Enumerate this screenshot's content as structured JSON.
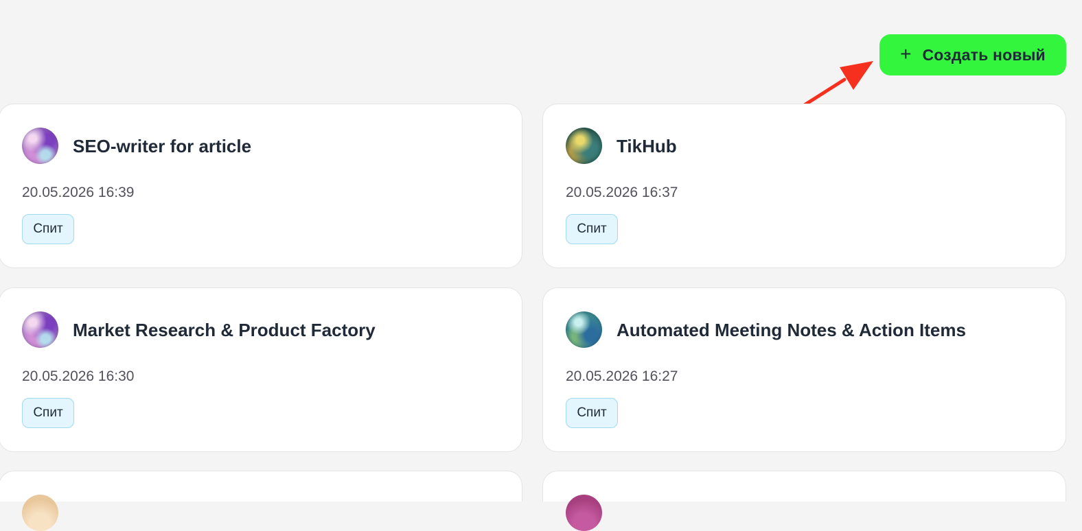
{
  "actions": {
    "create_label": "Создать новый",
    "create_icon": "plus-icon",
    "accent_color": "#33f53d"
  },
  "cards": [
    {
      "title": "SEO-writer for article",
      "date": "20.05.2026 16:39",
      "status": "Спит",
      "avatar": "purple-orb"
    },
    {
      "title": "TikHub",
      "date": "20.05.2026 16:37",
      "status": "Спит",
      "avatar": "green-gold-orb"
    },
    {
      "title": "Market Research & Product Factory",
      "date": "20.05.2026 16:30",
      "status": "Спит",
      "avatar": "purple-orb"
    },
    {
      "title": "Automated Meeting Notes & Action Items",
      "date": "20.05.2026 16:27",
      "status": "Спит",
      "avatar": "teal-orb"
    },
    {
      "title": "",
      "date": "",
      "status": "",
      "avatar": "peach-orb"
    },
    {
      "title": "",
      "date": "",
      "status": "",
      "avatar": "magenta-orb"
    }
  ],
  "annotation": {
    "icon": "red-arrow-icon",
    "color": "#f5301f"
  }
}
